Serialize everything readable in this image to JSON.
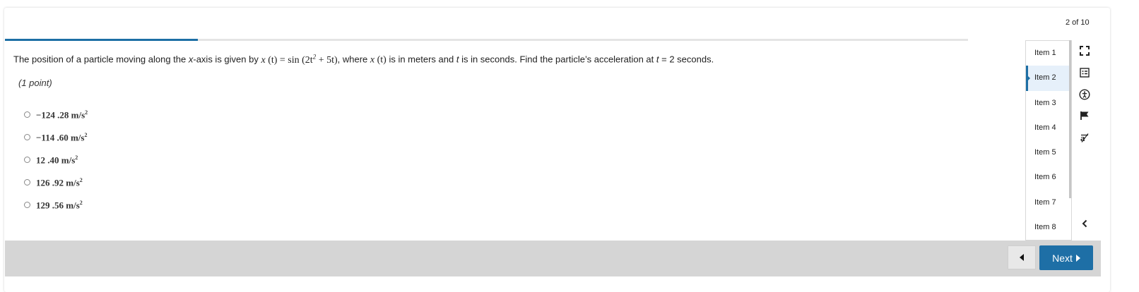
{
  "header": {
    "counter": "2 of 10"
  },
  "progress": {
    "fraction": 0.2
  },
  "question": {
    "prefix": "The position of a particle moving along the ",
    "axis_var": "x",
    "mid1": "-axis is given by ",
    "func_x": "x",
    "func_open": " (t) = ",
    "func_sin": "sin",
    "func_body": " (2t",
    "func_exp": "2",
    "func_tail": " + 5t)",
    "mid2": ", where ",
    "func2_x": "x",
    "func2_arg": " (t)",
    "mid3": " is in meters and ",
    "t_var": "t",
    "mid4": " is in seconds. Find the particle’s acceleration at ",
    "t_var2": "t",
    "suffix": " = 2 seconds.",
    "points": "(1 point)"
  },
  "options": [
    {
      "value": "−124 .28  m/s",
      "exp": "2"
    },
    {
      "value": "−114 .60  m/s",
      "exp": "2"
    },
    {
      "value": "12 .40  m/s",
      "exp": "2"
    },
    {
      "value": "126 .92  m/s",
      "exp": "2"
    },
    {
      "value": "129 .56  m/s",
      "exp": "2"
    }
  ],
  "items": [
    "Item 1",
    "Item 2",
    "Item 3",
    "Item 4",
    "Item 5",
    "Item 6",
    "Item 7",
    "Item 8"
  ],
  "active_item": "Item 2",
  "tools": [
    "fullscreen-icon",
    "notes-icon",
    "accessibility-icon",
    "flag-icon",
    "text-size-icon",
    "chevron-left-icon"
  ],
  "footer": {
    "next_label": "Next"
  },
  "colors": {
    "accent": "#1d6fa5",
    "footer_bg": "#d5d5d5",
    "active_item_bg": "#e6f0fa"
  }
}
